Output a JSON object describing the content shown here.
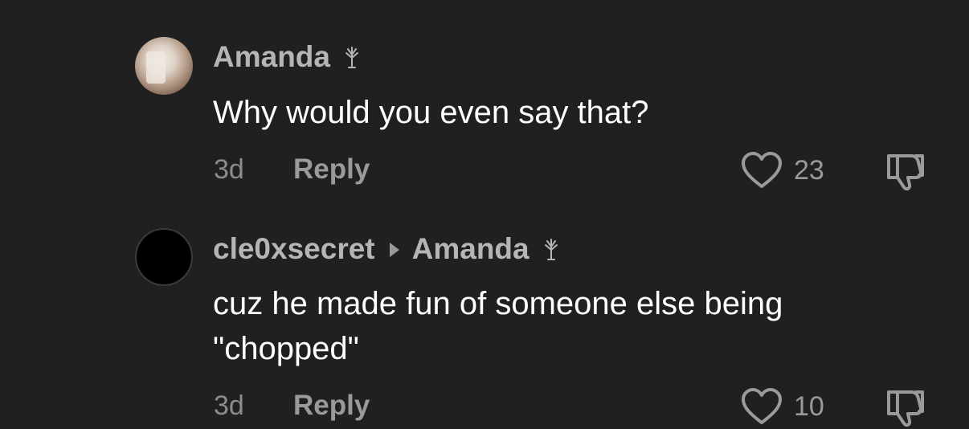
{
  "comments": [
    {
      "author": "Amanda",
      "text": "Why would you even say that?",
      "age": "3d",
      "reply_label": "Reply",
      "likes": "23"
    },
    {
      "author": "cle0xsecret",
      "reply_to": "Amanda",
      "text_line1": "cuz he made fun of someone else being",
      "text_line2": "\"chopped\"",
      "age": "3d",
      "reply_label": "Reply",
      "likes": "10"
    }
  ],
  "icons": {
    "creator_badge": "tree-icon",
    "like": "heart-outline-icon",
    "dislike": "thumbs-down-icon",
    "reply_arrow": "caret-right-icon"
  },
  "colors": {
    "background": "#202020",
    "name": "#b5b5b5",
    "body": "#ffffff",
    "meta": "#8c8c8c"
  }
}
